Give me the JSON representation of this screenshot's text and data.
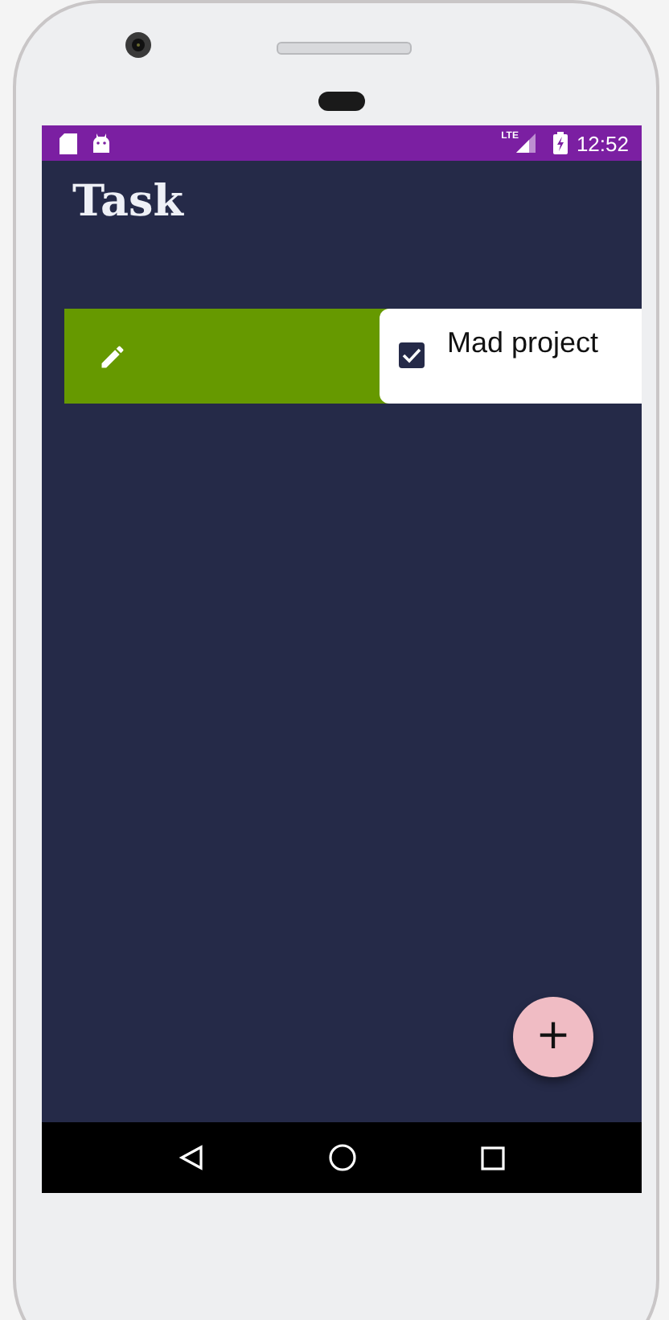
{
  "status_bar": {
    "network": "LTE",
    "time": "12:52"
  },
  "app_bar": {
    "title": "Task"
  },
  "tasks": [
    {
      "title": "Mad project",
      "checked": true,
      "swiped": true
    }
  ],
  "fab": {
    "label": "+"
  }
}
